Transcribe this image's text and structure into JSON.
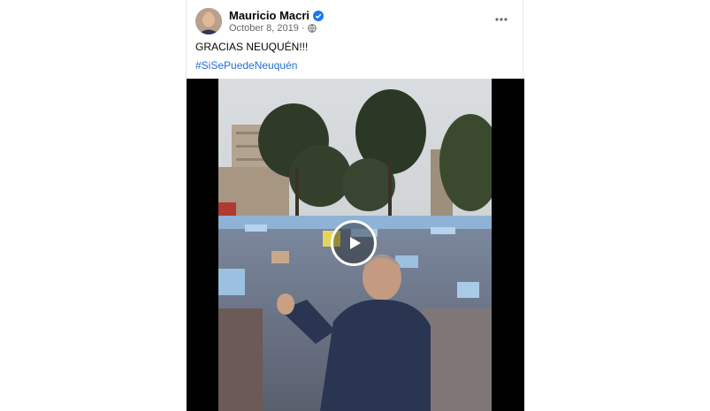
{
  "post": {
    "author": "Mauricio Macri",
    "date": "October 8, 2019",
    "separator": "·",
    "text": "GRACIAS NEUQUÉN!!!",
    "hashtag": "#SiSePuedeNeuquén"
  },
  "icons": {
    "verified": "verified-badge-icon",
    "audience": "globe-icon",
    "more": "more-options-icon",
    "play": "play-icon"
  },
  "colors": {
    "link": "#216fdb",
    "verified": "#1877f2",
    "text": "#050505",
    "meta": "#65676b"
  }
}
